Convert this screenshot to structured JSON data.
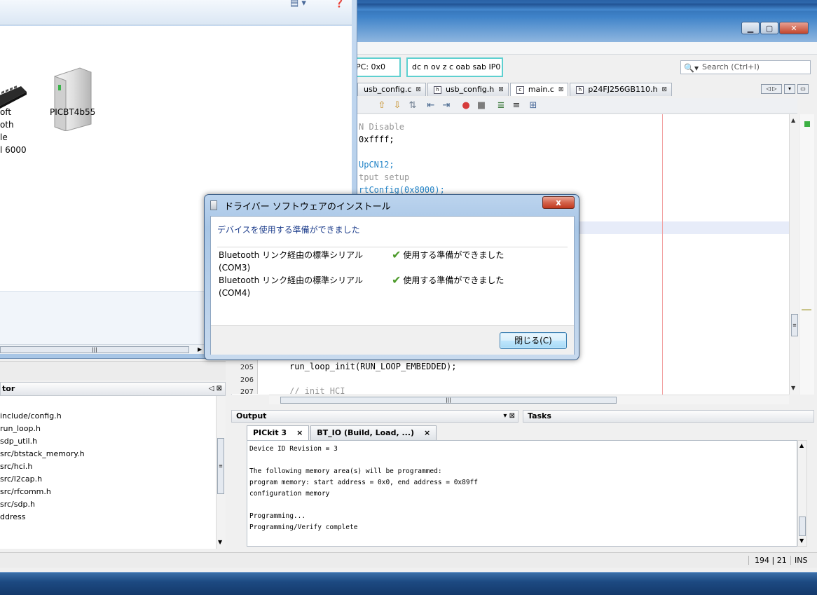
{
  "ide": {
    "toolbar": {
      "pc_readout": "PC: 0x0",
      "flags_readout": "dc n ov z c oab sab IP0",
      "search_placeholder": "Search (Ctrl+I)"
    },
    "editor_tabs": [
      {
        "label": "usb_config.c",
        "active": false
      },
      {
        "label": "usb_config.h",
        "active": false
      },
      {
        "label": "main.c",
        "active": true
      },
      {
        "label": "p24FJ256GB110.h",
        "active": false
      }
    ],
    "code_lines": [
      {
        "text": "N Disable",
        "kind": "comment"
      },
      {
        "text": "0xffff;",
        "kind": "code"
      },
      {
        "text": "UpCN12;",
        "kind": "func"
      },
      {
        "text": "tput setup",
        "kind": "comment"
      },
      {
        "text": "rtConfig(0x8000);",
        "kind": "func"
      }
    ],
    "line_numbers": [
      "205",
      "206",
      "207"
    ],
    "code_tail": [
      {
        "text": "run_loop_init(RUN_LOOP_EMBEDDED);",
        "kind": "code"
      },
      {
        "text": "// init HCI",
        "kind": "comment"
      }
    ],
    "output": {
      "panel_title": "Output",
      "tasks_title": "Tasks",
      "tabs": [
        {
          "label": "PICkit 3",
          "active": true
        },
        {
          "label": "BT_IO (Build, Load, ...)",
          "active": false
        }
      ],
      "lines": [
        "Device ID Revision = 3",
        "",
        "The following memory area(s) will be programmed:",
        "program memory: start address = 0x0, end address = 0x89ff",
        "configuration memory",
        "",
        "Programming...",
        "Programming/Verify complete"
      ]
    },
    "navigator": {
      "title": "tor",
      "items": [
        "include/config.h",
        "run_loop.h",
        "sdp_util.h",
        "src/btstack_memory.h",
        "src/hci.h",
        "src/l2cap.h",
        "src/rfcomm.h",
        "src/sdp.h",
        "ddress"
      ]
    },
    "statusbar": {
      "position": "194 | 21",
      "mode": "INS"
    }
  },
  "explorer": {
    "devices": [
      {
        "label": "oft\noth\nle\nl 6000",
        "icon": "keyboard-icon"
      },
      {
        "label": "PICBT4b55",
        "icon": "hard-drive-icon"
      }
    ]
  },
  "dialog": {
    "title": "ドライバー ソフトウェアのインストール",
    "close_glyph": "x",
    "heading": "デバイスを使用する準備ができました",
    "devices": [
      {
        "name": "Bluetooth リンク経由の標準シリアル\n(COM3)",
        "status": "使用する準備ができました"
      },
      {
        "name": "Bluetooth リンク経由の標準シリアル\n(COM4)",
        "status": "使用する準備ができました"
      }
    ],
    "close_button_label": "閉じる(C)"
  }
}
